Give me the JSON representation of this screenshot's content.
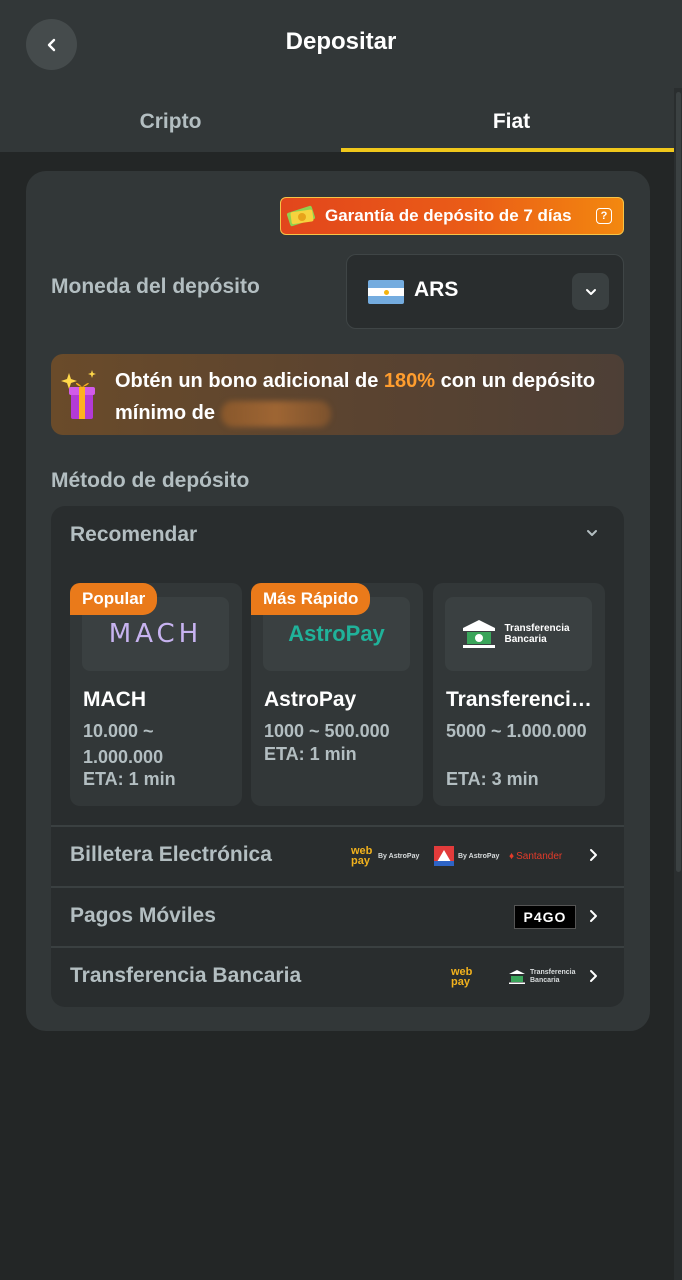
{
  "header": {
    "title": "Depositar",
    "tabs": [
      {
        "label": "Cripto",
        "active": false
      },
      {
        "label": "Fiat",
        "active": true
      }
    ]
  },
  "guarantee": {
    "text": "Garantía de depósito de 7 días",
    "help": "?"
  },
  "currency": {
    "label": "Moneda del depósito",
    "value": "ARS"
  },
  "bonus": {
    "text_before": "Obtén un bono adicional de ",
    "percent": "180%",
    "text_after": " con un depósito mínimo de"
  },
  "deposit_method": {
    "label": "Método de depósito",
    "recommended_title": "Recomendar",
    "cards": [
      {
        "badge": "Popular",
        "logo_text": "MACH",
        "name": "MACH",
        "range": "10.000 ~ 1.000.000",
        "eta": "ETA: 1 min"
      },
      {
        "badge": "Más Rápido",
        "logo_text": "AstroPay",
        "name": "AstroPay",
        "range": "1000 ~ 500.000",
        "eta": "ETA: 1 min"
      },
      {
        "badge": "",
        "logo_text": "Transferencia Bancaria",
        "name": "Transferencia Bancaria",
        "range": "5000 ~ 1.000.000",
        "eta": "ETA: 3 min"
      }
    ],
    "rows": [
      {
        "label": "Billetera Electrónica"
      },
      {
        "label": "Pagos Móviles"
      },
      {
        "label": "Transferencia Bancaria"
      }
    ],
    "row_logos": {
      "webpay": "web pay",
      "by_astropay": "By AstroPay",
      "santander": "Santander",
      "p4go": "P4GO",
      "transferencia": "Transferencia Bancaria"
    }
  },
  "colors": {
    "background": "#232626",
    "panel": "#323738",
    "accent_yellow": "#f0c71b",
    "accent_orange": "#ea7a1a",
    "highlight": "#ff9d2e"
  },
  "icons": [
    "back-icon",
    "help-icon",
    "chevron-down-icon",
    "gift-icon",
    "chevron-right-icon",
    "bank-icon"
  ]
}
